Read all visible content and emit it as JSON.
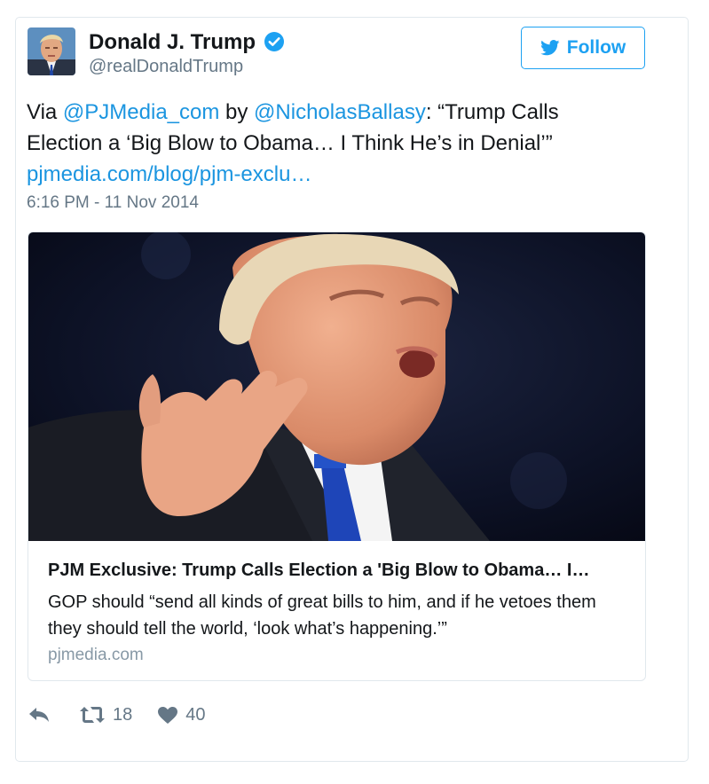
{
  "user": {
    "name": "Donald J. Trump",
    "handle": "@realDonaldTrump",
    "avatar_icon": "profile-avatar"
  },
  "follow": {
    "label": "Follow",
    "icon": "twitter-bird-icon",
    "color": "#1da1f2"
  },
  "tweet": {
    "prefix": "Via ",
    "mention1": "@PJMedia_com",
    "middle": " by ",
    "mention2": "@NicholasBallasy",
    "quote": ": “Trump Calls Election a ‘Big Blow to Obama… I Think He’s in Denial’”",
    "link": "pjmedia.com/blog/pjm-exclu…",
    "timestamp": "6:16 PM - 11 Nov 2014"
  },
  "card": {
    "title": "PJM Exclusive: Trump Calls Election a 'Big Blow to Obama… I…",
    "description": "GOP should “send all kinds of great bills to him, and if he vetoes them they should tell the world, ‘look what’s happening.’”",
    "domain": "pjmedia.com"
  },
  "actions": {
    "reply_icon": "reply-icon",
    "retweet_icon": "retweet-icon",
    "retweet_count": "18",
    "like_icon": "heart-icon",
    "like_count": "40"
  },
  "colors": {
    "link": "#1b95e0",
    "muted": "#657786",
    "border": "#e1e8ed"
  }
}
